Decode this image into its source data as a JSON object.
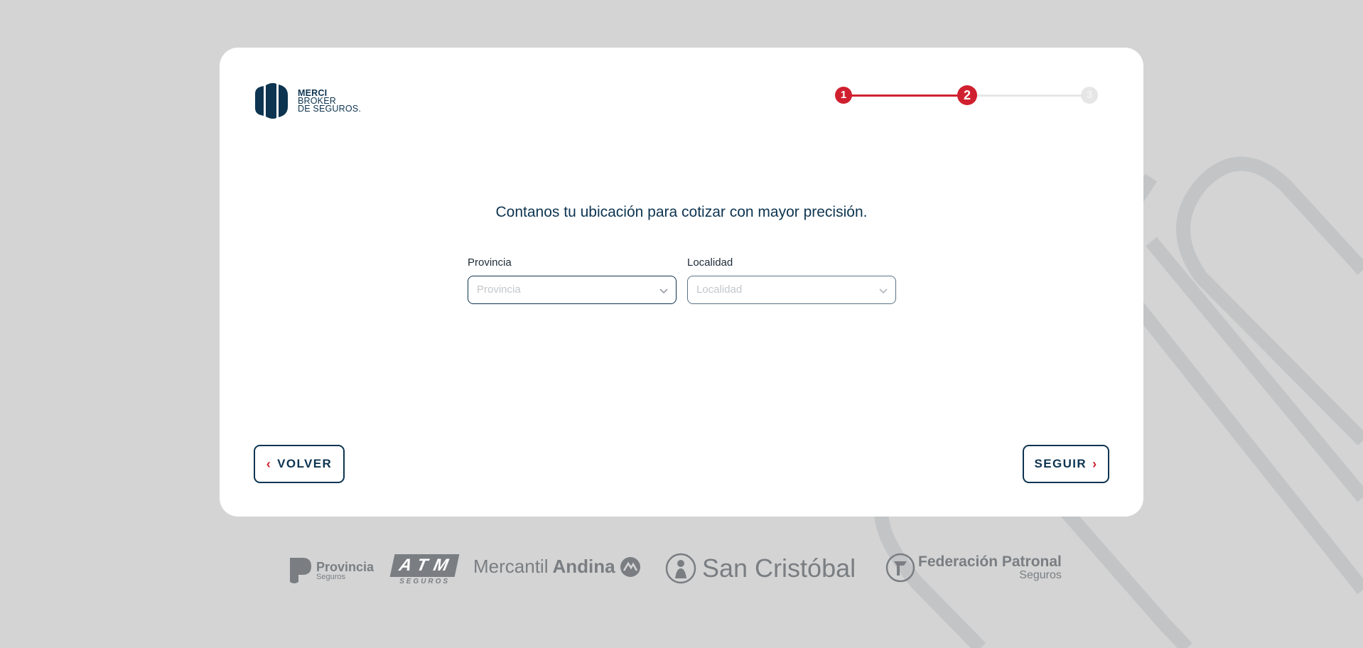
{
  "brand": {
    "line1": "MERCI",
    "line2": "BROKER",
    "line3": "DE SEGUROS."
  },
  "stepper": {
    "steps": [
      "1",
      "2",
      "3"
    ],
    "current": 2,
    "active_color": "#d0202f",
    "inactive_color": "#e6e6e6"
  },
  "form": {
    "headline": "Contanos tu ubicación para cotizar con mayor precisión.",
    "provincia": {
      "label": "Provincia",
      "placeholder": "Provincia"
    },
    "localidad": {
      "label": "Localidad",
      "placeholder": "Localidad"
    }
  },
  "nav": {
    "back_label": "VOLVER",
    "next_label": "SEGUIR"
  },
  "partners": {
    "provincia": {
      "name": "Provincia",
      "sub": "Seguros"
    },
    "atm": {
      "name": "ATM",
      "sub": "SEGUROS"
    },
    "mercantil": {
      "name_a": "Mercantil",
      "name_b": "Andina"
    },
    "sancristobal": {
      "name": "San Cristóbal"
    },
    "federacion": {
      "name": "Federación Patronal",
      "sub": "Seguros"
    }
  },
  "colors": {
    "primary": "#0d3450",
    "accent": "#d0202f",
    "background": "#d4d4d4",
    "card": "#ffffff"
  }
}
